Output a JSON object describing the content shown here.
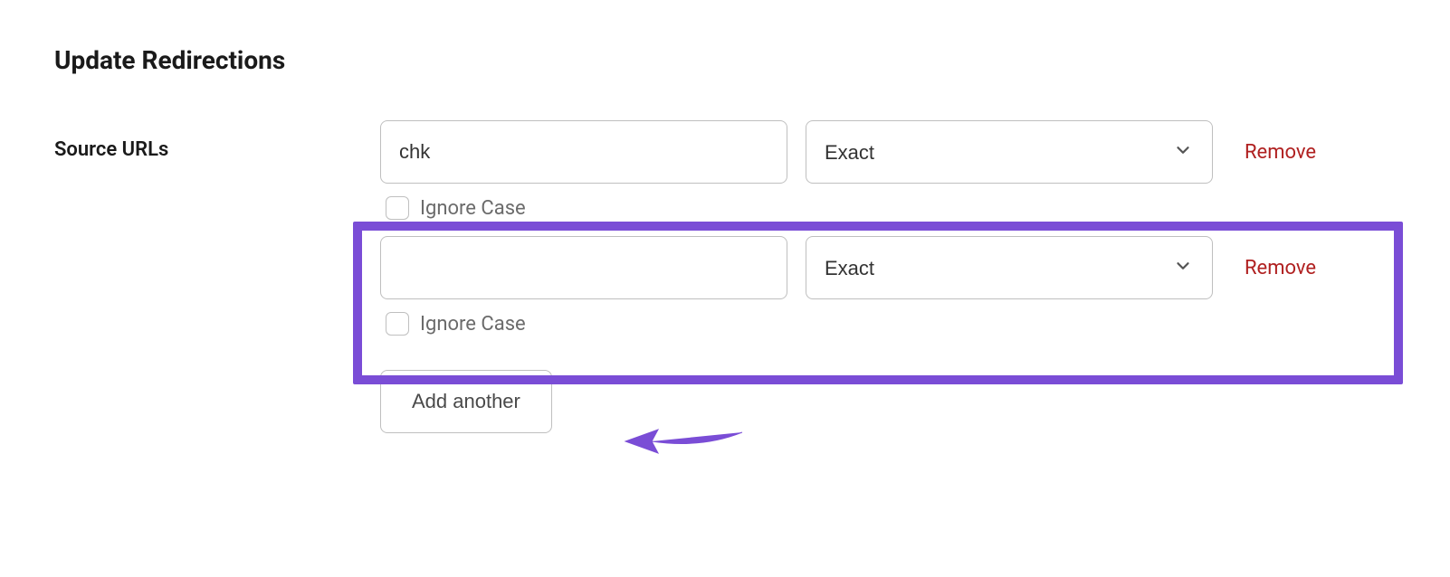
{
  "page": {
    "title": "Update Redirections"
  },
  "form": {
    "label": "Source URLs",
    "rows": [
      {
        "value": "chk",
        "match": "Exact",
        "ignore_case_label": "Ignore Case",
        "remove_label": "Remove"
      },
      {
        "value": "",
        "match": "Exact",
        "ignore_case_label": "Ignore Case",
        "remove_label": "Remove"
      }
    ],
    "add_button_label": "Add another"
  },
  "annotation": {
    "highlight_color": "#7a4dd6"
  }
}
